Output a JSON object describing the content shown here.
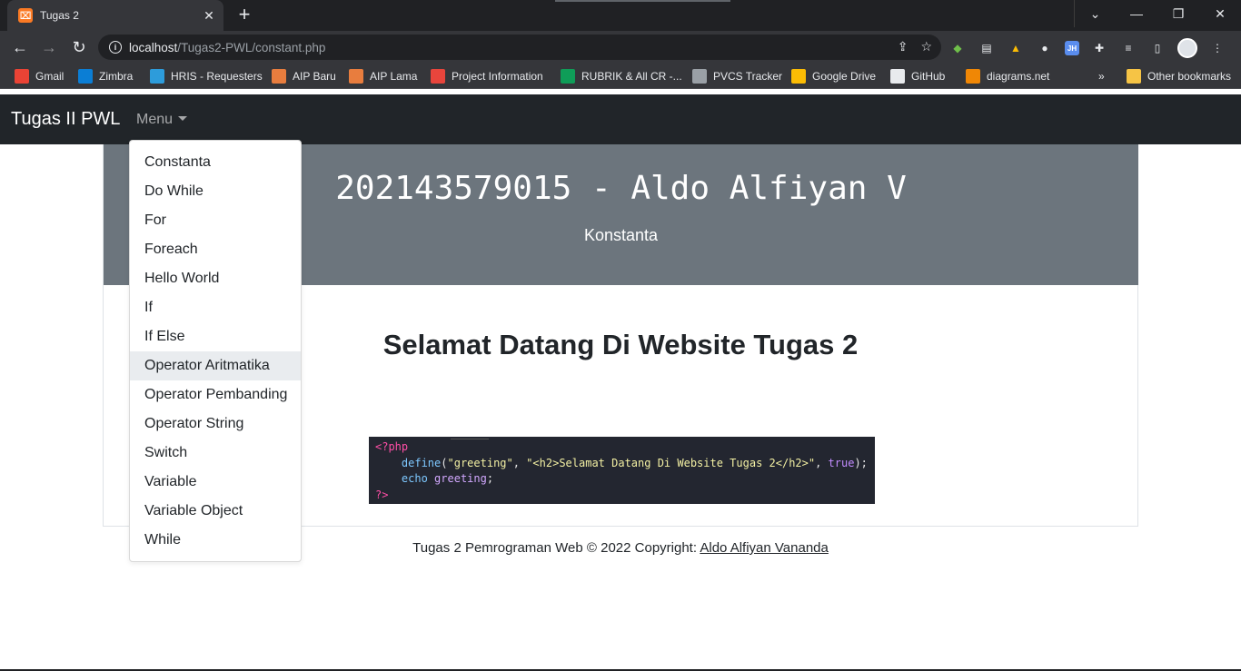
{
  "browser": {
    "tab_title": "Tugas 2",
    "tab_favicon": "xampp-icon",
    "url_host": "localhost",
    "url_path": "/Tugas2-PWL/constant.php",
    "bookmarks": [
      {
        "label": "Gmail",
        "icon": "gmail-icon",
        "color": "#ea4335"
      },
      {
        "label": "Zimbra",
        "icon": "zimbra-icon",
        "color": "#0b7ed5"
      },
      {
        "label": "HRIS - Requesters",
        "icon": "hris-icon",
        "color": "#2d9cdb"
      },
      {
        "label": "AIP Baru",
        "icon": "aip-icon",
        "color": "#e87d3e"
      },
      {
        "label": "AIP Lama",
        "icon": "aip-icon",
        "color": "#e87d3e"
      },
      {
        "label": "Project Information",
        "icon": "project-icon",
        "color": "#e8453c"
      },
      {
        "label": "RUBRIK & All CR -...",
        "icon": "sheets-icon",
        "color": "#0f9d58"
      },
      {
        "label": "PVCS Tracker",
        "icon": "globe-icon",
        "color": "#9aa0a6"
      },
      {
        "label": "Google Drive",
        "icon": "drive-icon",
        "color": "#fbbc04"
      },
      {
        "label": "GitHub",
        "icon": "github-icon",
        "color": "#e8eaed"
      },
      {
        "label": "diagrams.net",
        "icon": "diagrams-icon",
        "color": "#f08705"
      }
    ],
    "bookmarks_overflow": "»",
    "other_bookmarks": "Other bookmarks"
  },
  "navbar": {
    "brand": "Tugas II PWL",
    "menu_label": "Menu"
  },
  "dropdown": {
    "items": [
      "Constanta",
      "Do While",
      "For",
      "Foreach",
      "Hello World",
      "If",
      "If Else",
      "Operator Aritmatika",
      "Operator Pembanding",
      "Operator String",
      "Switch",
      "Variable",
      "Variable Object",
      "While"
    ],
    "highlighted": "Operator Aritmatika"
  },
  "header": {
    "title": "202143579015 - Aldo Alfiyan V",
    "subtitle": "Konstanta"
  },
  "main": {
    "welcome": "Selamat Datang Di Website Tugas 2"
  },
  "code": {
    "open_tag": "<?php",
    "line1_fn": "define",
    "line1_arg1": "\"greeting\"",
    "line1_arg2": "\"<h2>Selamat Datang Di Website Tugas 2</h2>\"",
    "line1_arg3": "true",
    "line2_kw": "echo",
    "line2_const": "greeting",
    "close_tag": "?>"
  },
  "footer": {
    "text": "Tugas 2 Pemrograman Web © 2022 Copyright: ",
    "link": "Aldo Alfiyan Vananda"
  }
}
